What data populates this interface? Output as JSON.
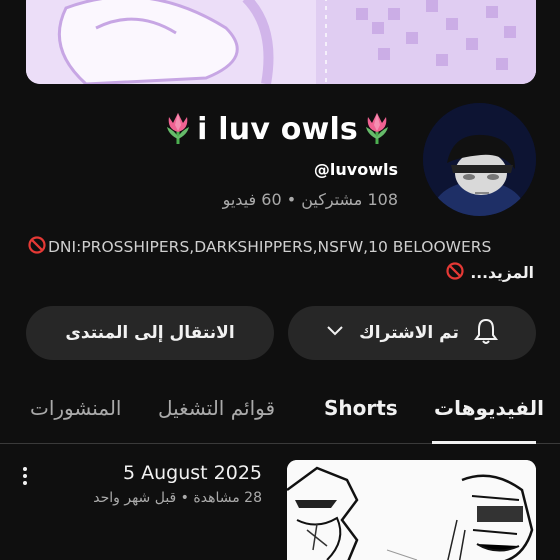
{
  "channel": {
    "name": "i luv owls",
    "handle": "@luvowls",
    "stats": "108 مشتركين • 60 فيديو",
    "description_line1": "DNI:PROSSHIPERS,DARKSHIPPERS,NSFW,10 BELOOWERS",
    "description_more": "المزيد..."
  },
  "actions": {
    "subscribed_label": "تم الاشتراك",
    "community_label": "الانتقال إلى المنتدى"
  },
  "tabs": {
    "videos": "الفيديوهات",
    "shorts": "Shorts",
    "playlists": "قوائم التشغيل",
    "posts": "المنشورات"
  },
  "video": {
    "title": "5 August 2025",
    "meta": "28 مشاهدة • قبل شهر واحد"
  },
  "icons": {
    "title_emoji": "tulip-icon",
    "no_entry": "no-entry-icon",
    "bell": "bell-icon",
    "chevron": "chevron-down-icon",
    "menu": "more-vertical-icon"
  },
  "colors": {
    "background": "#0f0f0f",
    "button": "#272727",
    "banner": "#e6d6f4",
    "no_entry_red": "#e53935",
    "tulip_pink": "#f06292"
  }
}
